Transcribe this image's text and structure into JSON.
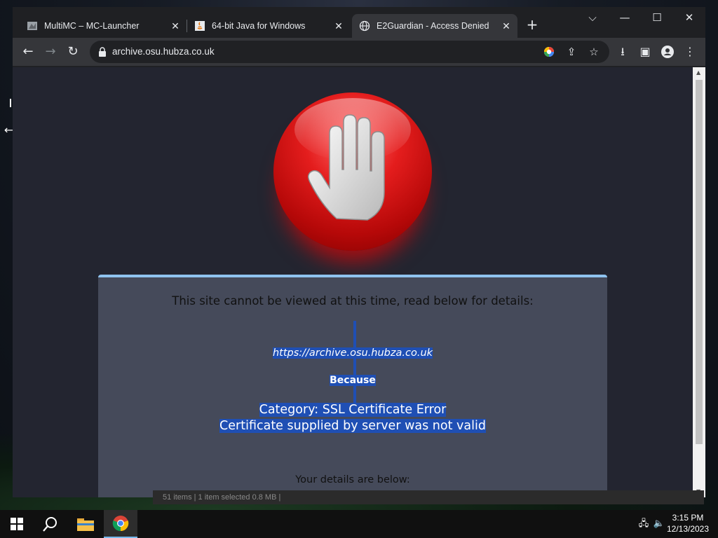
{
  "tabs": [
    {
      "title": "MultiMC – MC-Launcher",
      "icon": "multimc-icon",
      "active": false
    },
    {
      "title": "64-bit Java for Windows",
      "icon": "java-icon",
      "active": false
    },
    {
      "title": "E2Guardian - Access Denied",
      "icon": "globe-icon",
      "active": true
    }
  ],
  "tab_close_glyph": "✕",
  "new_tab_glyph": "+",
  "window_controls": {
    "dropdown": "⌵",
    "minimize": "—",
    "maximize": "☐",
    "close": "✕"
  },
  "toolbar": {
    "back": "←",
    "forward": "→",
    "reload": "↻",
    "url": "archive.osu.hubza.co.uk"
  },
  "page": {
    "heading": "This site cannot be viewed at this time, read below for details:",
    "blocked_url": "https://archive.osu.hubza.co.uk",
    "because_label": "Because",
    "category_line": "Category: SSL Certificate Error",
    "reason_line": "Certificate supplied by server was not valid",
    "details_label": "Your details are below:"
  },
  "explorer_status": "51 items   |   1 item selected  0.8 MB   |",
  "taskbar": {
    "clock_time": "3:15 PM",
    "clock_date": "12/13/2023"
  },
  "colors": {
    "selection": "#1f4fb4",
    "stop_red": "#e41d1d",
    "card_bg": "#454a5a",
    "card_accent": "#8fc3ef"
  }
}
